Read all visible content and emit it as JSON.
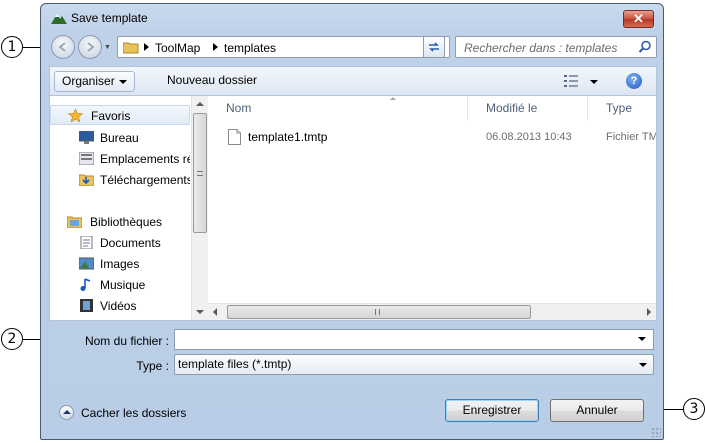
{
  "annotations": {
    "c1": "1",
    "c2": "2",
    "c3": "3"
  },
  "window": {
    "title": "Save template",
    "close_label": "✕"
  },
  "address": {
    "crumbs": [
      "ToolMap",
      "templates"
    ],
    "search_placeholder": "Rechercher dans : templates"
  },
  "toolbar": {
    "organize_label": "Organiser",
    "new_folder_label": "Nouveau dossier",
    "help_label": "?"
  },
  "nav": {
    "items": [
      {
        "label": "Favoris",
        "icon": "star-icon"
      },
      {
        "label": "Bureau",
        "icon": "desktop-icon"
      },
      {
        "label": "Emplacements récents",
        "icon": "recent-places-icon"
      },
      {
        "label": "Téléchargements",
        "icon": "downloads-icon"
      },
      {
        "label": "Bibliothèques",
        "icon": "libraries-icon"
      },
      {
        "label": "Documents",
        "icon": "documents-icon"
      },
      {
        "label": "Images",
        "icon": "pictures-icon"
      },
      {
        "label": "Musique",
        "icon": "music-icon"
      },
      {
        "label": "Vidéos",
        "icon": "videos-icon"
      }
    ]
  },
  "files": {
    "columns": [
      "Nom",
      "Modifié le",
      "Type"
    ],
    "rows": [
      {
        "name": "template1.tmtp",
        "modified": "06.08.2013 10:43",
        "type": "Fichier TMTP"
      }
    ],
    "scroll_grip": "III"
  },
  "form": {
    "filename_label": "Nom du fichier :",
    "filename_value": "",
    "type_label": "Type :",
    "type_value": "template files (*.tmtp)"
  },
  "footer": {
    "hide_folders_label": "Cacher les dossiers",
    "save_label": "Enregistrer",
    "cancel_label": "Annuler"
  },
  "colors": {
    "frame": "#bfd1e8",
    "close_button": "#c7503c",
    "default_button_border": "#3c7fb1"
  }
}
